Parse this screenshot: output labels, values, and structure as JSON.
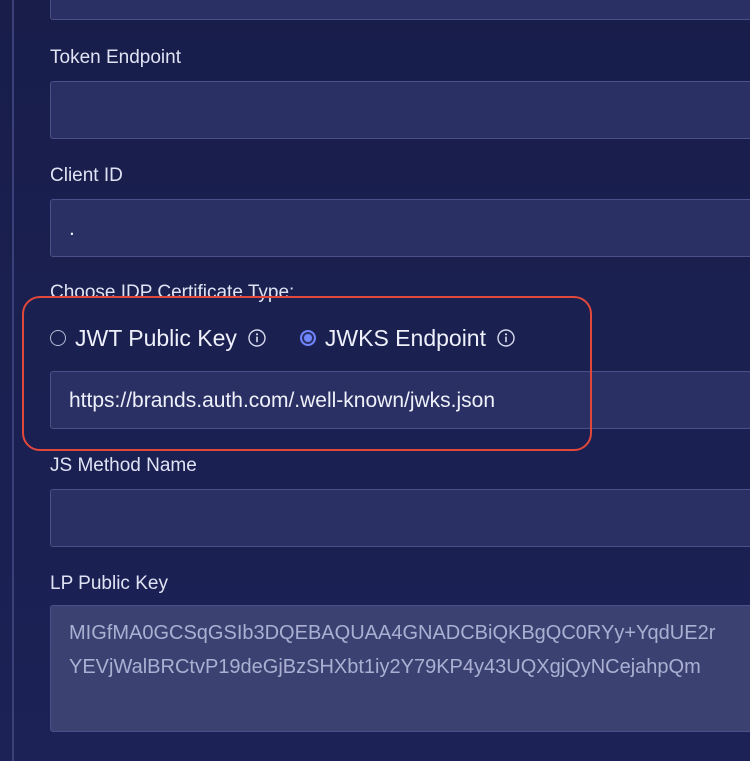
{
  "form": {
    "top_field": {
      "value": ""
    },
    "token_endpoint": {
      "label": "Token Endpoint",
      "value": ""
    },
    "client_id": {
      "label": "Client ID",
      "value": "."
    },
    "certificate_type": {
      "label": "Choose IDP Certificate Type:",
      "options": [
        {
          "label": "JWT Public Key",
          "selected": false,
          "icon": "info-icon"
        },
        {
          "label": "JWKS Endpoint",
          "selected": true,
          "icon": "info-icon"
        }
      ],
      "jwks_url": "https://brands.auth.com/.well-known/jwks.json",
      "highlight_color": "#e0483b"
    },
    "js_method_name": {
      "label": "JS Method Name",
      "value": ""
    },
    "lp_public_key": {
      "label": "LP Public Key",
      "lines": [
        "MIGfMA0GCSqGSIb3DQEBAQUAA4GNADCBiQKBgQC0RYy+YqdUE2r",
        "YEVjWalBRCtvP19deGjBzSHXbt1iy2Y79KP4y43UQXgjQyNCejahpQm"
      ]
    }
  },
  "colors": {
    "background": "#1a2050",
    "field_background": "#2a3063",
    "accent": "#6f86ff"
  }
}
